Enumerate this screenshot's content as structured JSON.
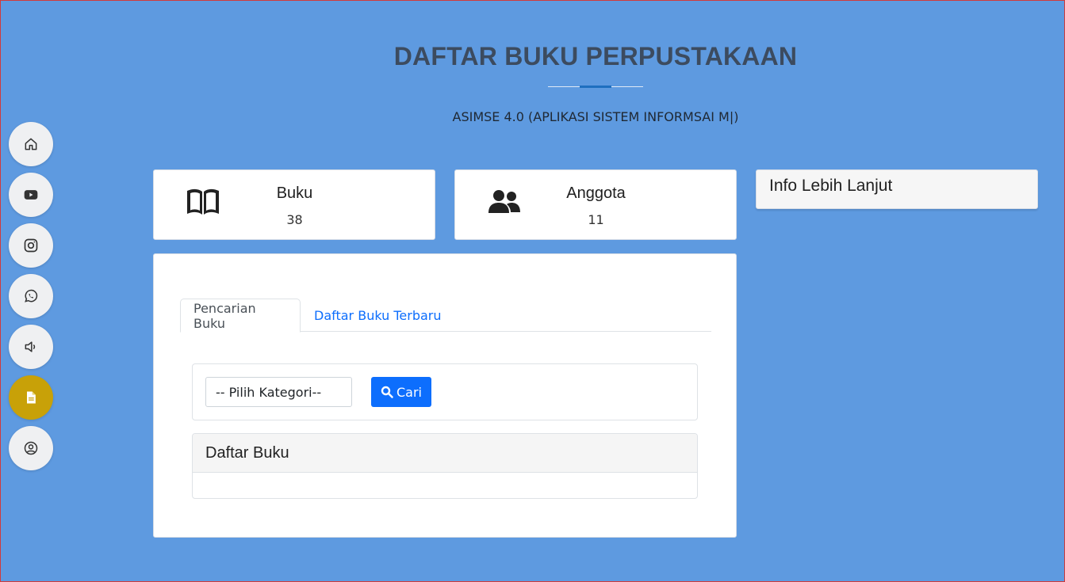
{
  "header": {
    "title": "DAFTAR BUKU PERPUSTAKAAN",
    "subtitle": "ASIMSE 4.0 (APLIKASI SISTEM INFORMSAI M|)"
  },
  "side_nav": {
    "items": [
      {
        "icon": "home-icon"
      },
      {
        "icon": "youtube-icon"
      },
      {
        "icon": "instagram-icon"
      },
      {
        "icon": "whatsapp-icon"
      },
      {
        "icon": "speaker-icon"
      },
      {
        "icon": "document-icon",
        "active": true
      },
      {
        "icon": "user-circle-icon"
      }
    ],
    "active_color": "#c8a108"
  },
  "stats": {
    "books": {
      "label": "Buku",
      "value": "38",
      "icon": "book-icon"
    },
    "members": {
      "label": "Anggota",
      "value": "11",
      "icon": "users-icon"
    }
  },
  "info_card": {
    "title": "Info Lebih Lanjut"
  },
  "tabs": [
    {
      "label": "Pencarian Buku",
      "active": true
    },
    {
      "label": "Daftar Buku Terbaru",
      "active": false
    }
  ],
  "search": {
    "category_select": "-- Pilih Kategori--",
    "button_label": "Cari"
  },
  "book_list": {
    "title": "Daftar Buku"
  },
  "colors": {
    "background": "#5e9ae0",
    "primary_button": "#0d6efd",
    "link": "#0d6efd"
  }
}
